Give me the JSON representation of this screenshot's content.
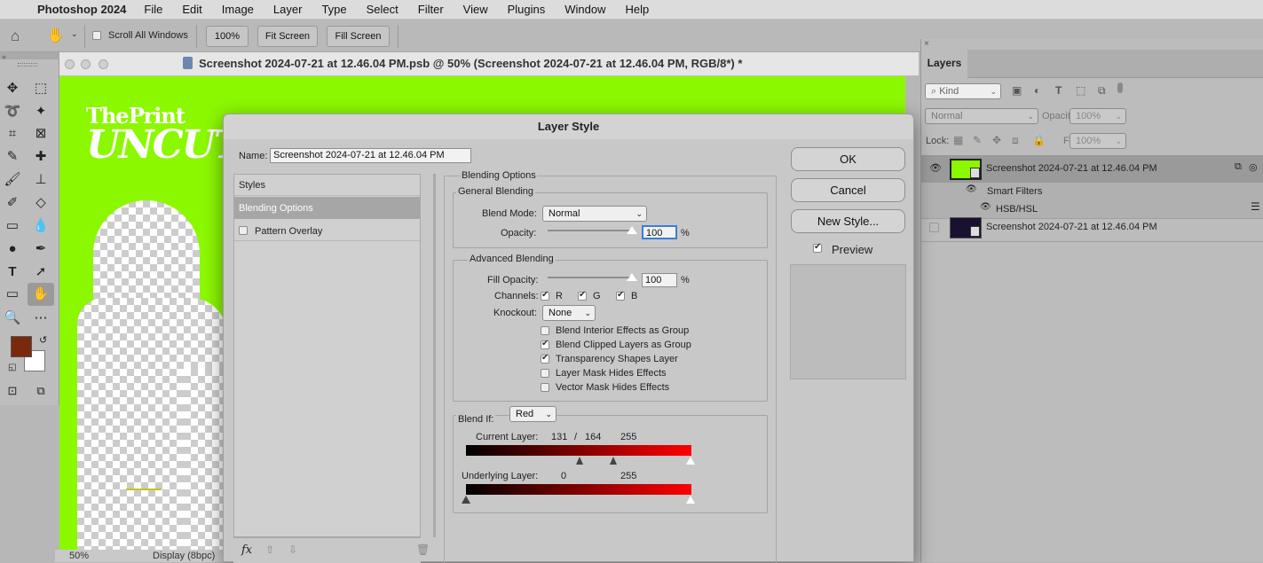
{
  "menubar": {
    "apple_icon": "apple-logo",
    "app_name": "Photoshop 2024",
    "items": [
      "File",
      "Edit",
      "Image",
      "Layer",
      "Type",
      "Select",
      "Filter",
      "View",
      "Plugins",
      "Window",
      "Help"
    ]
  },
  "optbar": {
    "scroll_all": "Scroll All Windows",
    "zoom_100": "100%",
    "fit_screen": "Fit Screen",
    "fill_screen": "Fill Screen"
  },
  "document": {
    "title": "Screenshot 2024-07-21 at 12.46.04 PM.psb @ 50% (Screenshot 2024-07-21 at 12.46.04 PM, RGB/8*) *",
    "art_line1": "ThePrint",
    "art_line2": "UNCUT",
    "zoom": "50%",
    "display": "Display (8bpc)"
  },
  "colors": {
    "foreground": "#7a2a0c",
    "background": "#ffffff",
    "canvas_green": "#8cf800"
  },
  "layers": {
    "tab": "Layers",
    "kind": "Kind",
    "blend": "Normal",
    "opacity_label": "Opacity:",
    "opacity_value": "100%",
    "lock_label": "Lock:",
    "fill_label": "Fill:",
    "fill_value": "100%",
    "layer1": "Screenshot 2024-07-21 at 12.46.04 PM",
    "smart_filters": "Smart Filters",
    "hsb": "HSB/HSL",
    "layer2": "Screenshot 2024-07-21 at 12.46.04 PM"
  },
  "dialog": {
    "title": "Layer Style",
    "name_label": "Name:",
    "name_value": "Screenshot 2024-07-21 at 12.46.04 PM",
    "list": {
      "styles": "Styles",
      "blending_options": "Blending Options",
      "pattern_overlay": "Pattern Overlay"
    },
    "buttons": {
      "ok": "OK",
      "cancel": "Cancel",
      "new_style": "New Style...",
      "preview": "Preview"
    },
    "blending_options_heading": "Blending Options",
    "general": {
      "heading": "General Blending",
      "blend_mode_label": "Blend Mode:",
      "blend_mode_value": "Normal",
      "opacity_label": "Opacity:",
      "opacity_value": "100",
      "opacity_fraction": 1.0,
      "percent": "%"
    },
    "advanced": {
      "heading": "Advanced Blending",
      "fill_opacity_label": "Fill Opacity:",
      "fill_opacity_value": "100",
      "fill_opacity_fraction": 1.0,
      "percent": "%",
      "channels_label": "Channels:",
      "channel_r": "R",
      "channel_g": "G",
      "channel_b": "B",
      "knockout_label": "Knockout:",
      "knockout_value": "None",
      "options": [
        {
          "label": "Blend Interior Effects as Group",
          "checked": false
        },
        {
          "label": "Blend Clipped Layers as Group",
          "checked": true
        },
        {
          "label": "Transparency Shapes Layer",
          "checked": true
        },
        {
          "label": "Layer Mask Hides Effects",
          "checked": false
        },
        {
          "label": "Vector Mask Hides Effects",
          "checked": false
        }
      ]
    },
    "blend_if": {
      "label": "Blend If:",
      "channel": "Red",
      "current_label": "Current Layer:",
      "current_low": "131",
      "slash": "/",
      "current_mid": "164",
      "current_high": "255",
      "underlying_label": "Underlying Layer:",
      "underlying_low": "0",
      "underlying_high": "255"
    }
  }
}
